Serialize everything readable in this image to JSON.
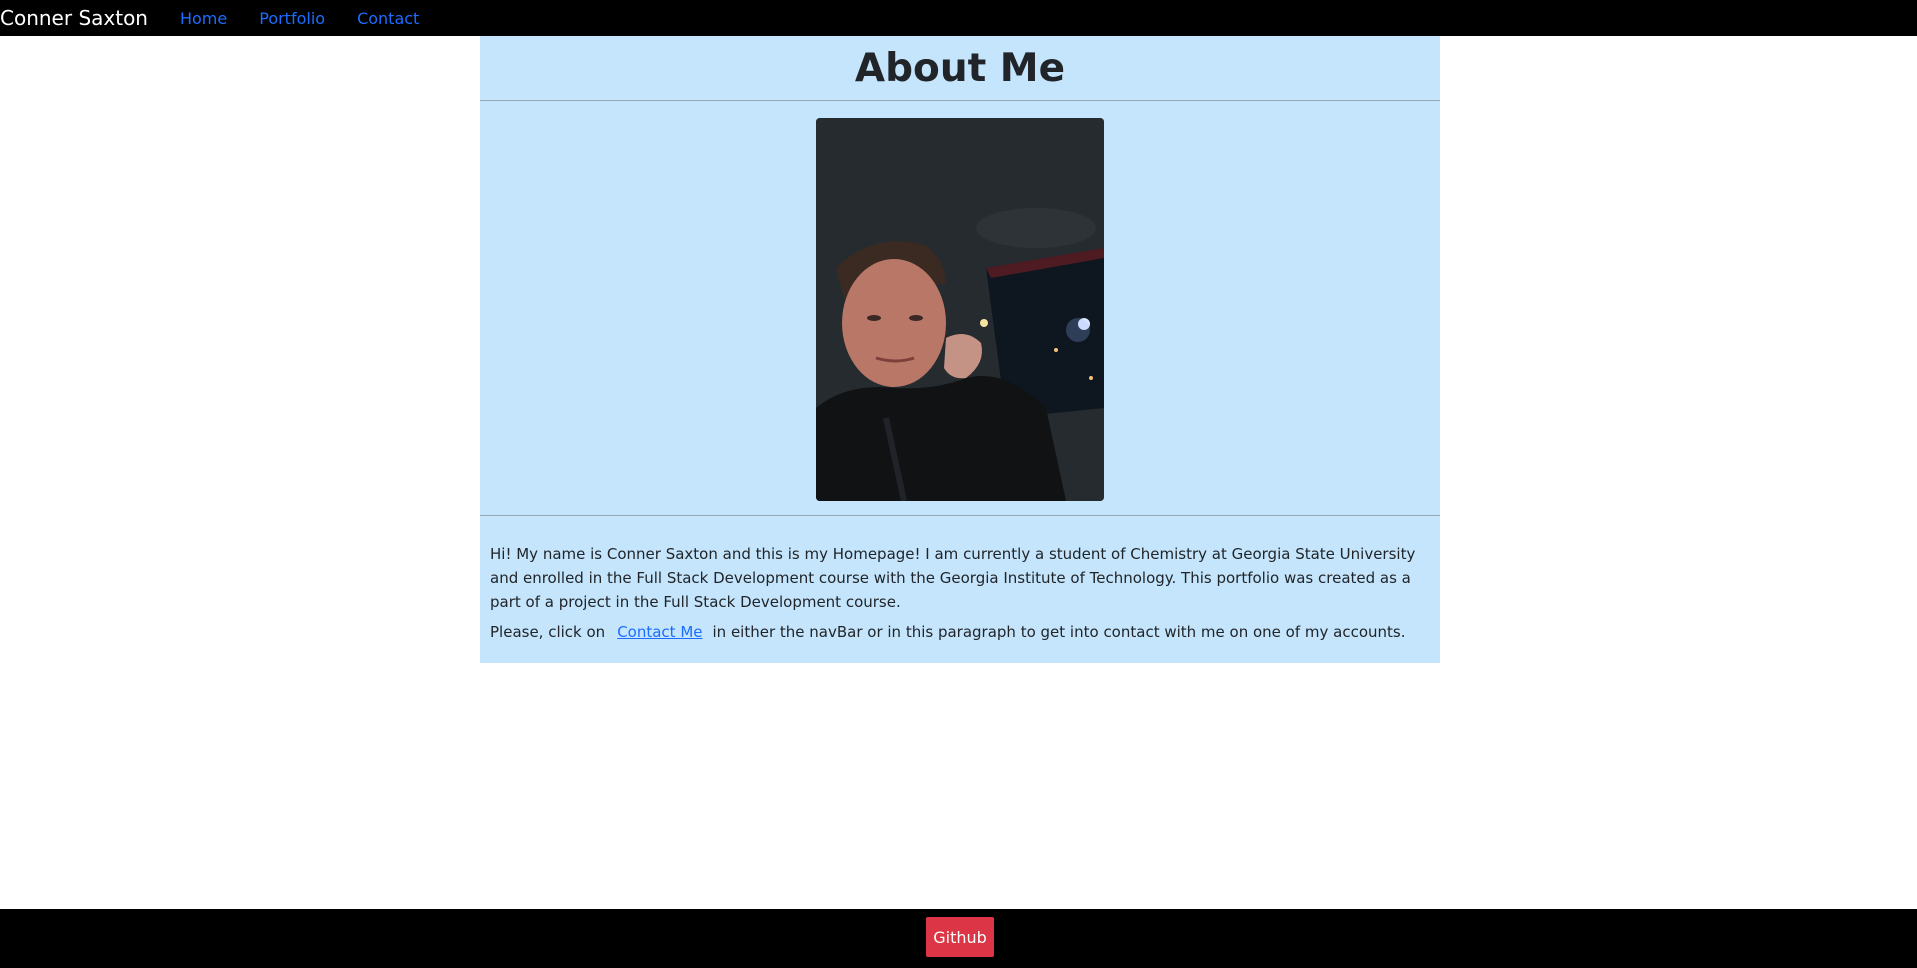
{
  "navbar": {
    "brand": "Conner Saxton",
    "links": [
      {
        "label": "Home"
      },
      {
        "label": "Portfolio"
      },
      {
        "label": "Contact"
      }
    ]
  },
  "about": {
    "title": "About Me",
    "paragraph1": "Hi! My name is Conner Saxton and this is my Homepage! I am currently a student of Chemistry at Georgia State University and enrolled in the Full Stack Development course with the Georgia Institute of Technology. This portfolio was created as a part of a project in the Full Stack Development course.",
    "paragraph2_before": "Please, click on",
    "contact_link": "Contact Me",
    "paragraph2_after": "in either the navBar or in this paragraph to get into contact with me on one of my accounts."
  },
  "footer": {
    "github_label": "Github"
  },
  "colors": {
    "navbar_bg": "#000000",
    "card_bg": "#c4e5fc",
    "link": "#1a6dff",
    "github_button": "#dc3545"
  }
}
